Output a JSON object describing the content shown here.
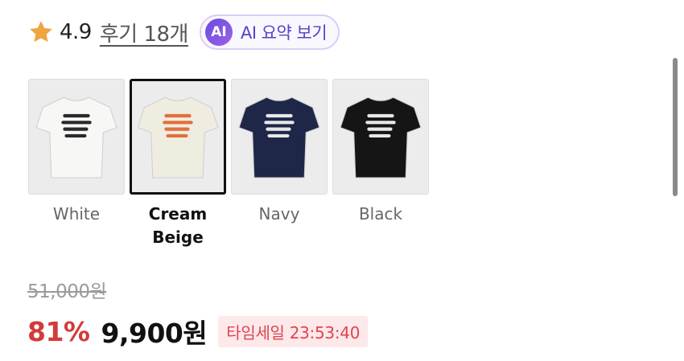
{
  "rating": {
    "score": "4.9",
    "reviews_label": "후기 18개",
    "ai_badge": "AI",
    "ai_button_label": "AI 요약 보기",
    "star_color": "#f0a440"
  },
  "colors": {
    "options": [
      {
        "label": "White",
        "shirt_color": "#f7f7f5",
        "print_color": "#2a2a2a",
        "selected": false
      },
      {
        "label": "Cream Beige",
        "shirt_color": "#efece0",
        "print_color": "#e0703c",
        "selected": true
      },
      {
        "label": "Navy",
        "shirt_color": "#1f2748",
        "print_color": "#e8e8e8",
        "selected": false
      },
      {
        "label": "Black",
        "shirt_color": "#151515",
        "print_color": "#e8e8e8",
        "selected": false
      }
    ]
  },
  "pricing": {
    "original_price": "51,000원",
    "discount_rate": "81%",
    "sale_price": "9,900원",
    "timesale_label": "타임세일 23:53:40"
  }
}
